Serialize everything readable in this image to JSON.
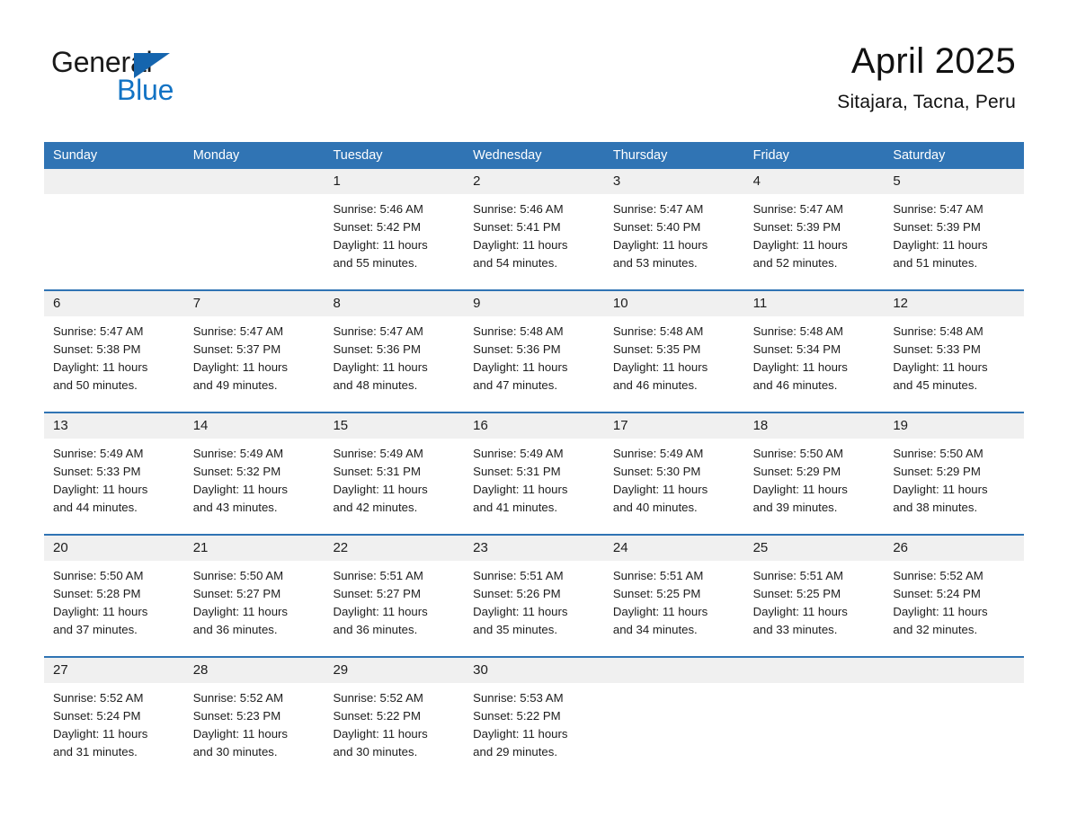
{
  "brand": {
    "name_part1": "General",
    "name_part2": "Blue",
    "triangle_color": "#1565ae",
    "blue_color": "#1273c4"
  },
  "header": {
    "title": "April 2025",
    "subtitle": "Sitajara, Tacna, Peru"
  },
  "theme": {
    "header_blue": "#3074b4",
    "date_band_gray": "#f0f0f0",
    "text_color": "#1d1d1d"
  },
  "weekdays": [
    "Sunday",
    "Monday",
    "Tuesday",
    "Wednesday",
    "Thursday",
    "Friday",
    "Saturday"
  ],
  "weeks": [
    [
      {
        "day": "",
        "sunrise": "",
        "sunset": "",
        "daylight1": "",
        "daylight2": ""
      },
      {
        "day": "",
        "sunrise": "",
        "sunset": "",
        "daylight1": "",
        "daylight2": ""
      },
      {
        "day": "1",
        "sunrise": "Sunrise: 5:46 AM",
        "sunset": "Sunset: 5:42 PM",
        "daylight1": "Daylight: 11 hours",
        "daylight2": "and 55 minutes."
      },
      {
        "day": "2",
        "sunrise": "Sunrise: 5:46 AM",
        "sunset": "Sunset: 5:41 PM",
        "daylight1": "Daylight: 11 hours",
        "daylight2": "and 54 minutes."
      },
      {
        "day": "3",
        "sunrise": "Sunrise: 5:47 AM",
        "sunset": "Sunset: 5:40 PM",
        "daylight1": "Daylight: 11 hours",
        "daylight2": "and 53 minutes."
      },
      {
        "day": "4",
        "sunrise": "Sunrise: 5:47 AM",
        "sunset": "Sunset: 5:39 PM",
        "daylight1": "Daylight: 11 hours",
        "daylight2": "and 52 minutes."
      },
      {
        "day": "5",
        "sunrise": "Sunrise: 5:47 AM",
        "sunset": "Sunset: 5:39 PM",
        "daylight1": "Daylight: 11 hours",
        "daylight2": "and 51 minutes."
      }
    ],
    [
      {
        "day": "6",
        "sunrise": "Sunrise: 5:47 AM",
        "sunset": "Sunset: 5:38 PM",
        "daylight1": "Daylight: 11 hours",
        "daylight2": "and 50 minutes."
      },
      {
        "day": "7",
        "sunrise": "Sunrise: 5:47 AM",
        "sunset": "Sunset: 5:37 PM",
        "daylight1": "Daylight: 11 hours",
        "daylight2": "and 49 minutes."
      },
      {
        "day": "8",
        "sunrise": "Sunrise: 5:47 AM",
        "sunset": "Sunset: 5:36 PM",
        "daylight1": "Daylight: 11 hours",
        "daylight2": "and 48 minutes."
      },
      {
        "day": "9",
        "sunrise": "Sunrise: 5:48 AM",
        "sunset": "Sunset: 5:36 PM",
        "daylight1": "Daylight: 11 hours",
        "daylight2": "and 47 minutes."
      },
      {
        "day": "10",
        "sunrise": "Sunrise: 5:48 AM",
        "sunset": "Sunset: 5:35 PM",
        "daylight1": "Daylight: 11 hours",
        "daylight2": "and 46 minutes."
      },
      {
        "day": "11",
        "sunrise": "Sunrise: 5:48 AM",
        "sunset": "Sunset: 5:34 PM",
        "daylight1": "Daylight: 11 hours",
        "daylight2": "and 46 minutes."
      },
      {
        "day": "12",
        "sunrise": "Sunrise: 5:48 AM",
        "sunset": "Sunset: 5:33 PM",
        "daylight1": "Daylight: 11 hours",
        "daylight2": "and 45 minutes."
      }
    ],
    [
      {
        "day": "13",
        "sunrise": "Sunrise: 5:49 AM",
        "sunset": "Sunset: 5:33 PM",
        "daylight1": "Daylight: 11 hours",
        "daylight2": "and 44 minutes."
      },
      {
        "day": "14",
        "sunrise": "Sunrise: 5:49 AM",
        "sunset": "Sunset: 5:32 PM",
        "daylight1": "Daylight: 11 hours",
        "daylight2": "and 43 minutes."
      },
      {
        "day": "15",
        "sunrise": "Sunrise: 5:49 AM",
        "sunset": "Sunset: 5:31 PM",
        "daylight1": "Daylight: 11 hours",
        "daylight2": "and 42 minutes."
      },
      {
        "day": "16",
        "sunrise": "Sunrise: 5:49 AM",
        "sunset": "Sunset: 5:31 PM",
        "daylight1": "Daylight: 11 hours",
        "daylight2": "and 41 minutes."
      },
      {
        "day": "17",
        "sunrise": "Sunrise: 5:49 AM",
        "sunset": "Sunset: 5:30 PM",
        "daylight1": "Daylight: 11 hours",
        "daylight2": "and 40 minutes."
      },
      {
        "day": "18",
        "sunrise": "Sunrise: 5:50 AM",
        "sunset": "Sunset: 5:29 PM",
        "daylight1": "Daylight: 11 hours",
        "daylight2": "and 39 minutes."
      },
      {
        "day": "19",
        "sunrise": "Sunrise: 5:50 AM",
        "sunset": "Sunset: 5:29 PM",
        "daylight1": "Daylight: 11 hours",
        "daylight2": "and 38 minutes."
      }
    ],
    [
      {
        "day": "20",
        "sunrise": "Sunrise: 5:50 AM",
        "sunset": "Sunset: 5:28 PM",
        "daylight1": "Daylight: 11 hours",
        "daylight2": "and 37 minutes."
      },
      {
        "day": "21",
        "sunrise": "Sunrise: 5:50 AM",
        "sunset": "Sunset: 5:27 PM",
        "daylight1": "Daylight: 11 hours",
        "daylight2": "and 36 minutes."
      },
      {
        "day": "22",
        "sunrise": "Sunrise: 5:51 AM",
        "sunset": "Sunset: 5:27 PM",
        "daylight1": "Daylight: 11 hours",
        "daylight2": "and 36 minutes."
      },
      {
        "day": "23",
        "sunrise": "Sunrise: 5:51 AM",
        "sunset": "Sunset: 5:26 PM",
        "daylight1": "Daylight: 11 hours",
        "daylight2": "and 35 minutes."
      },
      {
        "day": "24",
        "sunrise": "Sunrise: 5:51 AM",
        "sunset": "Sunset: 5:25 PM",
        "daylight1": "Daylight: 11 hours",
        "daylight2": "and 34 minutes."
      },
      {
        "day": "25",
        "sunrise": "Sunrise: 5:51 AM",
        "sunset": "Sunset: 5:25 PM",
        "daylight1": "Daylight: 11 hours",
        "daylight2": "and 33 minutes."
      },
      {
        "day": "26",
        "sunrise": "Sunrise: 5:52 AM",
        "sunset": "Sunset: 5:24 PM",
        "daylight1": "Daylight: 11 hours",
        "daylight2": "and 32 minutes."
      }
    ],
    [
      {
        "day": "27",
        "sunrise": "Sunrise: 5:52 AM",
        "sunset": "Sunset: 5:24 PM",
        "daylight1": "Daylight: 11 hours",
        "daylight2": "and 31 minutes."
      },
      {
        "day": "28",
        "sunrise": "Sunrise: 5:52 AM",
        "sunset": "Sunset: 5:23 PM",
        "daylight1": "Daylight: 11 hours",
        "daylight2": "and 30 minutes."
      },
      {
        "day": "29",
        "sunrise": "Sunrise: 5:52 AM",
        "sunset": "Sunset: 5:22 PM",
        "daylight1": "Daylight: 11 hours",
        "daylight2": "and 30 minutes."
      },
      {
        "day": "30",
        "sunrise": "Sunrise: 5:53 AM",
        "sunset": "Sunset: 5:22 PM",
        "daylight1": "Daylight: 11 hours",
        "daylight2": "and 29 minutes."
      },
      {
        "day": "",
        "sunrise": "",
        "sunset": "",
        "daylight1": "",
        "daylight2": ""
      },
      {
        "day": "",
        "sunrise": "",
        "sunset": "",
        "daylight1": "",
        "daylight2": ""
      },
      {
        "day": "",
        "sunrise": "",
        "sunset": "",
        "daylight1": "",
        "daylight2": ""
      }
    ]
  ]
}
